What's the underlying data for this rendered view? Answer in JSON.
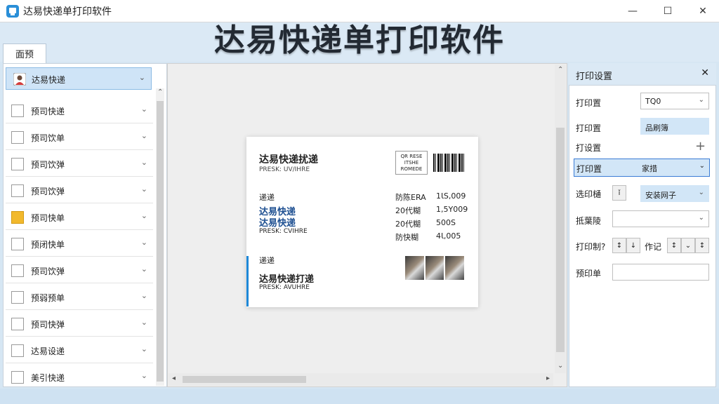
{
  "window": {
    "title": "达易快递单打印软件",
    "minimize": "—",
    "maximize": "☐",
    "close": "✕"
  },
  "banner": {
    "title": "达易快递单打印软件"
  },
  "tabs": [
    {
      "label": "面预"
    }
  ],
  "sidebar": {
    "selected": {
      "label": "达易快递"
    },
    "items": [
      {
        "label": "预司快递",
        "icon": "document-icon"
      },
      {
        "label": "预司饮单",
        "icon": "document-icon"
      },
      {
        "label": "预司饮弹",
        "icon": "document-icon"
      },
      {
        "label": "预司饮弹",
        "icon": "document-icon"
      },
      {
        "label": "预司快单",
        "icon": "folder-icon"
      },
      {
        "label": "预闭快单",
        "icon": "document-icon"
      },
      {
        "label": "预司饮弹",
        "icon": "document-icon"
      },
      {
        "label": "预弱预单",
        "icon": "document-icon"
      },
      {
        "label": "预司快弹",
        "icon": "document-icon"
      },
      {
        "label": "达易设递",
        "icon": "document-icon"
      },
      {
        "label": "美引快递",
        "icon": "document-icon"
      }
    ]
  },
  "label_card": {
    "header_title": "达易快递扰递",
    "header_sub": "PRESK: UV/IHRE",
    "qr_text": [
      "QR RESE",
      "ITSHE",
      "ROMEDE"
    ],
    "section1": "递递",
    "sender_name_1": "达易快递",
    "sender_name_2": "达易快递",
    "sender_sub": "PRESK: CVIHRE",
    "rows": [
      {
        "label": "防陈ERA",
        "value": "1ƖS,009"
      },
      {
        "label": "20代糊",
        "value": "1,5Y009"
      },
      {
        "label": "20代糊",
        "value": "500S"
      },
      {
        "label": "防快糊",
        "value": "4Ɩ,005"
      }
    ],
    "section2": "递递",
    "receiver_name": "达易快递打递",
    "receiver_sub": "PRESK: AVUHRE"
  },
  "settings": {
    "title": "打印设置",
    "close": "✕",
    "rows": [
      {
        "label": "打印置",
        "value": "TQ0"
      },
      {
        "label": "打印置",
        "value": "品刷簿"
      },
      {
        "label": "打设置",
        "value": "+"
      },
      {
        "label": "打印置",
        "value": "家措"
      },
      {
        "label": "选印樋",
        "value": "安装网子",
        "btn": "ǐ"
      },
      {
        "label": "抵葉陵",
        "value": ""
      },
      {
        "label": "打印制?",
        "extra_label": "作记"
      },
      {
        "label": "预印单",
        "value": ""
      }
    ]
  },
  "colors": {
    "accent": "#1e88d8",
    "banner_bg": "#dbe9f5",
    "selected_bg": "#cfe4f7"
  }
}
